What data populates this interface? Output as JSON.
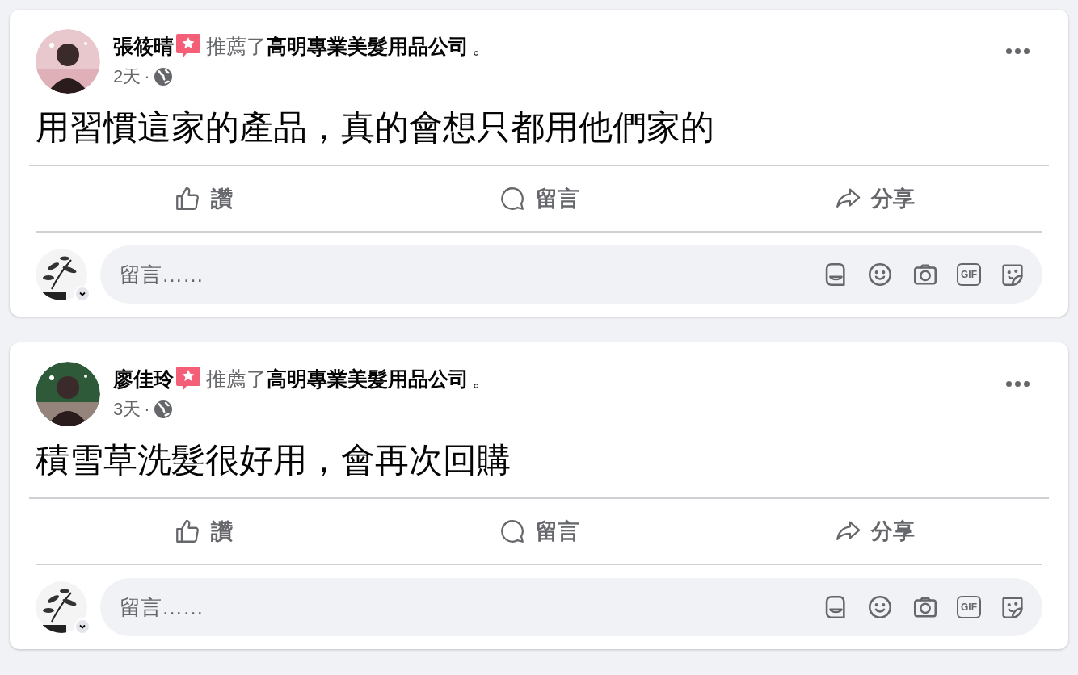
{
  "posts": [
    {
      "author": "張筱晴",
      "action": "推薦了",
      "page": "高明專業美髮用品公司",
      "end": "。",
      "time": "2天",
      "separator": "·",
      "text": "用習慣這家的產品，真的會想只都用他們家的",
      "actions": [
        "讚",
        "留言",
        "分享"
      ],
      "composer": {
        "placeholder": "留言……",
        "gif_label": "GIF"
      }
    },
    {
      "author": "廖佳玲",
      "action": "推薦了",
      "page": "高明專業美髮用品公司",
      "end": "。",
      "time": "3天",
      "separator": "·",
      "text": "積雪草洗髮很好用，會再次回購",
      "actions": [
        "讚",
        "留言",
        "分享"
      ],
      "composer": {
        "placeholder": "留言……",
        "gif_label": "GIF"
      }
    }
  ]
}
